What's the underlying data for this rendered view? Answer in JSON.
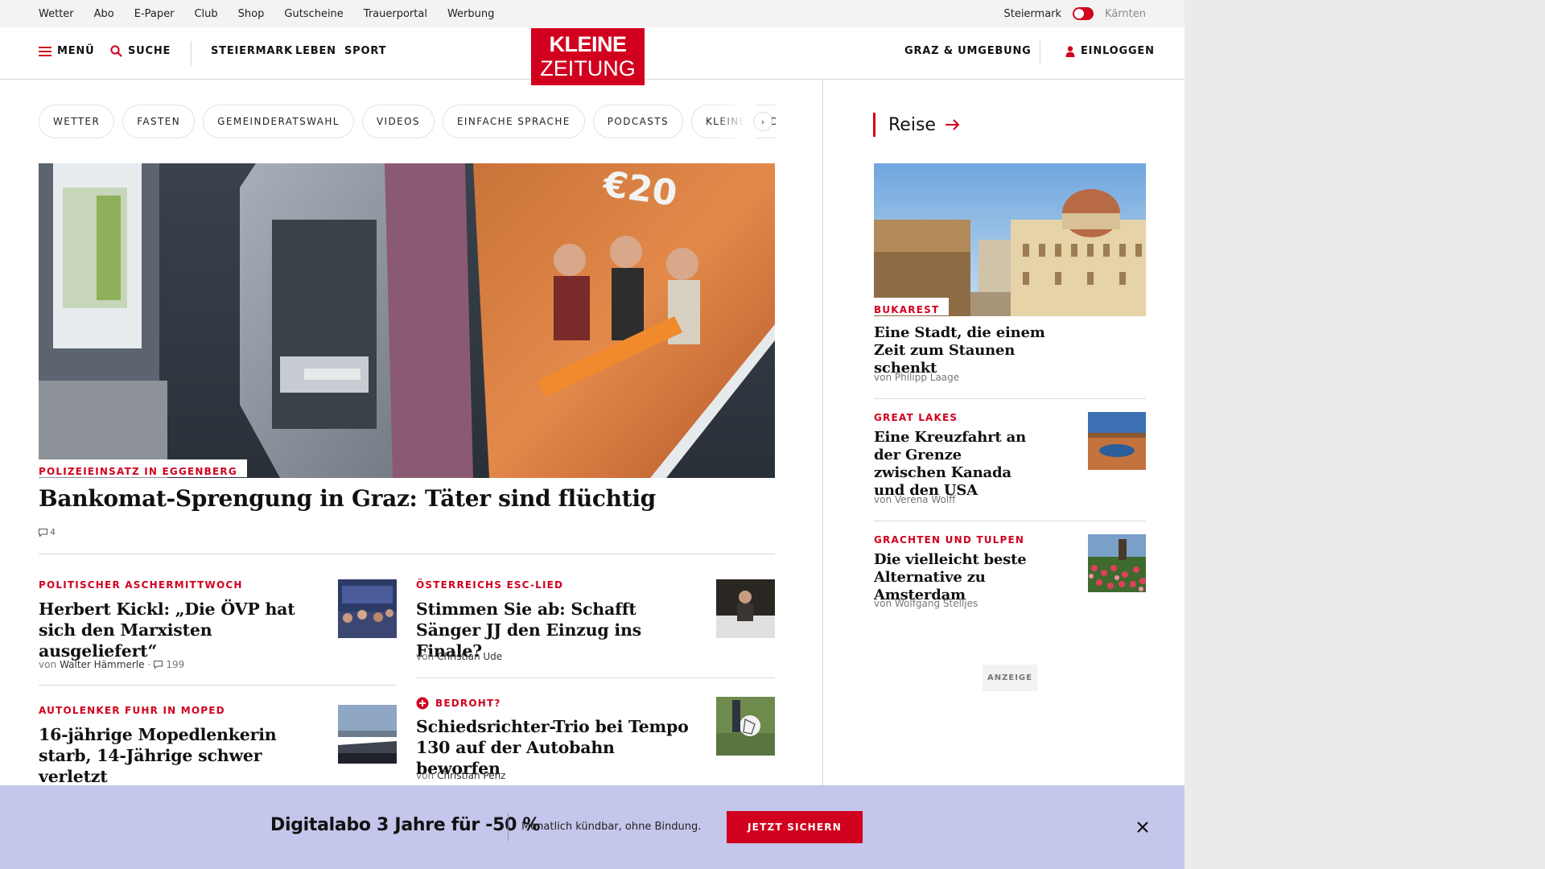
{
  "utilbar": {
    "links": [
      "Wetter",
      "Abo",
      "E-Paper",
      "Club",
      "Shop",
      "Gutscheine",
      "Trauerportal",
      "Werbung"
    ],
    "region_active": "Steiermark",
    "region_other": "Kärnten"
  },
  "header": {
    "menu_label": "MENÜ",
    "search_label": "SUCHE",
    "nav": [
      "STEIERMARK",
      "LEBEN",
      "SPORT"
    ],
    "logo_line1": "KLEINE",
    "logo_line2": "ZEITUNG",
    "region_link": "GRAZ & UMGEBUNG",
    "login_label": "EINLOGGEN"
  },
  "chips": [
    "WETTER",
    "FASTEN",
    "GEMEINDERATSWAHL",
    "VIDEOS",
    "EINFACHE SPRACHE",
    "PODCASTS",
    "KLEINE KINDER"
  ],
  "hero": {
    "kicker": "POLIZEIEINSATZ IN EGGENBERG",
    "title": "Bankomat-Sprengung in Graz: Täter sind flüchtig",
    "comments": "4"
  },
  "articles": [
    {
      "kicker": "POLITISCHER ASCHERMITTWOCH",
      "title": "Herbert Kickl: „Die ÖVP hat sich den Marxisten ausgeliefert“",
      "by": "von",
      "author": "Walter Hämmerle",
      "comments": "199"
    },
    {
      "kicker": "ÖSTERREICHS ESC-LIED",
      "title": "Stimmen Sie ab: Schafft Sänger JJ den Einzug ins Finale?",
      "by": "von",
      "author": "Christian Ude"
    },
    {
      "kicker": "AUTOLENKER FUHR IN MOPED",
      "title": "16-jährige Mopedlenkerin starb, 14-Jährige schwer verletzt"
    },
    {
      "kicker": "BEDROHT?",
      "title": "Schiedsrichter-Trio bei Tempo 130 auf der Autobahn beworfen",
      "by": "von",
      "author": "Christian Penz"
    }
  ],
  "sidebar": {
    "section": "Reise",
    "items": [
      {
        "kicker": "BUKAREST",
        "title": "Eine Stadt, die einem Zeit zum Staunen schenkt",
        "byline": "von Philipp Laage"
      },
      {
        "kicker": "GREAT LAKES",
        "title": "Eine Kreuzfahrt an der Grenze zwischen Kanada und den USA",
        "byline": "von Verena Wolff"
      },
      {
        "kicker": "GRACHTEN UND TULPEN",
        "title": "Die vielleicht beste Alternative zu Amsterdam",
        "byline": "von Wolfgang Stelljes"
      }
    ],
    "ad_label": "ANZEIGE"
  },
  "banner": {
    "headline": "Digitalabo 3 Jahre für -50 %",
    "subtext": "Monatlich kündbar, ohne Bindung.",
    "cta": "JETZT SICHERN"
  },
  "colors": {
    "accent": "#d1001f",
    "banner_bg": "#c4c6eb"
  }
}
